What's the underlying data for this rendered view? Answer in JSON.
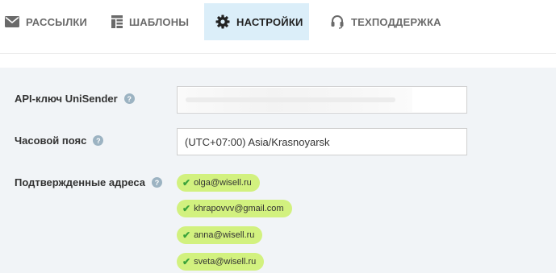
{
  "nav": {
    "tabs": [
      {
        "label": "РАССЫЛКИ",
        "icon": "envelope-icon",
        "active": false
      },
      {
        "label": "ШАБЛОНЫ",
        "icon": "template-icon",
        "active": false
      },
      {
        "label": "НАСТРОЙКИ",
        "icon": "gear-icon",
        "active": true
      },
      {
        "label": "ТЕХПОДДЕРЖКА",
        "icon": "headset-icon",
        "active": false
      }
    ]
  },
  "settings": {
    "api_key": {
      "label": "API-ключ UniSender",
      "help": "?",
      "value": ""
    },
    "timezone": {
      "label": "Часовой пояс",
      "help": "?",
      "value": "(UTC+07:00) Asia/Krasnoyarsk"
    },
    "confirmed": {
      "label": "Подтвержденные адреса",
      "help": "?",
      "emails": [
        "olga@wisell.ru",
        "khrapovvv@gmail.com",
        "anna@wisell.ru",
        "sveta@wisell.ru"
      ]
    }
  },
  "colors": {
    "active_tab_bg": "#dbeef9",
    "email_badge_bg": "#d2f17f",
    "check_green": "#3aa23a",
    "panel_bg": "#f1f4f7",
    "help_icon_bg": "#9cb3c2"
  }
}
